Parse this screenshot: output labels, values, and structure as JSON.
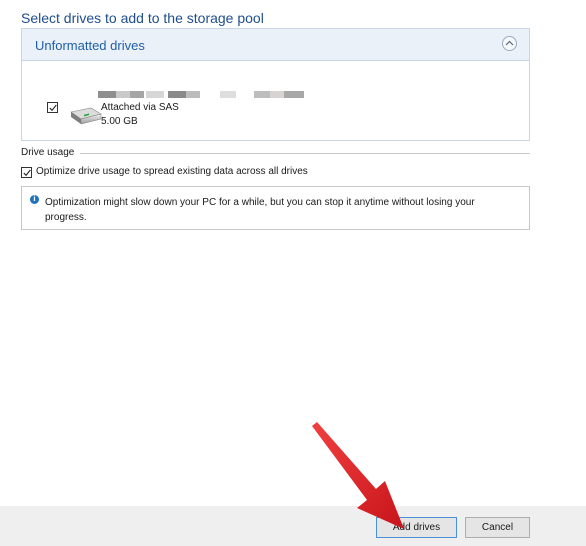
{
  "heading": "Select drives to add to the storage pool",
  "group": {
    "title": "Unformatted drives",
    "collapse_icon": "chevron-up-icon"
  },
  "drive": {
    "checked": true,
    "name_redacted": true,
    "connection": "Attached via SAS",
    "size": "5.00 GB",
    "icon": "hard-drive-icon"
  },
  "usage": {
    "section_label": "Drive usage",
    "optimize_checked": true,
    "optimize_label": "Optimize drive usage to spread existing data across all drives"
  },
  "info": {
    "icon": "info-icon",
    "text": "Optimization might slow down your PC for a while, but you can stop it anytime without losing your progress."
  },
  "footer": {
    "add_label": "Add drives",
    "cancel_label": "Cancel"
  },
  "annotation": {
    "arrow_color": "#e5222a",
    "points_to": "Add drives"
  },
  "colors": {
    "heading": "#1f4e8c",
    "group_header_bg": "#eaf1f9",
    "footer_bg": "#efefef"
  }
}
